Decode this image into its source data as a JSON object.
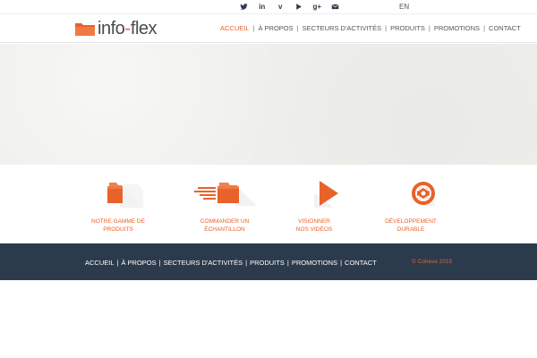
{
  "colors": {
    "accent": "#e8622a",
    "dark": "#2c3b4c",
    "hero_bg": "#efefec"
  },
  "social": [
    {
      "name": "twitter",
      "icon": "twitter-icon"
    },
    {
      "name": "linkedin",
      "icon": "linkedin-icon",
      "glyph": "in"
    },
    {
      "name": "vimeo",
      "icon": "vimeo-icon",
      "glyph": "v"
    },
    {
      "name": "youtube",
      "icon": "play-icon"
    },
    {
      "name": "google-plus",
      "icon": "google-plus-icon",
      "glyph": "g+"
    },
    {
      "name": "email",
      "icon": "mail-icon"
    }
  ],
  "lang": "EN",
  "logo": {
    "part1": "info",
    "dash": "-",
    "part2": "flex"
  },
  "nav": {
    "items": [
      "ACCUEIL",
      "À PROPOS",
      "SECTEURS D'ACTIVITÉS",
      "PRODUITS",
      "PROMOTIONS",
      "CONTACT"
    ],
    "separator": "|",
    "active": "ACCUEIL"
  },
  "features": [
    {
      "line1": "NOTRE GAMME DE",
      "line2": "PRODUITS",
      "icon": "folder-icon"
    },
    {
      "line1": "COMMANDER UN",
      "line2": "ÉCHANTILLON",
      "icon": "fast-folder-icon"
    },
    {
      "line1": "VISIONNER",
      "line2": "NOS VIDÉOS",
      "icon": "play-icon"
    },
    {
      "line1": "DÉVELOPPEMENT",
      "line2": "DURABLE",
      "icon": "recycle-icon"
    }
  ],
  "footer": {
    "nav": [
      "ACCUEIL",
      "À PROPOS",
      "SECTEURS D'ACTIVITÉS",
      "PRODUITS",
      "PROMOTIONS",
      "CONTACT"
    ],
    "separator": "|",
    "copyright": "© Cohese 2015"
  }
}
